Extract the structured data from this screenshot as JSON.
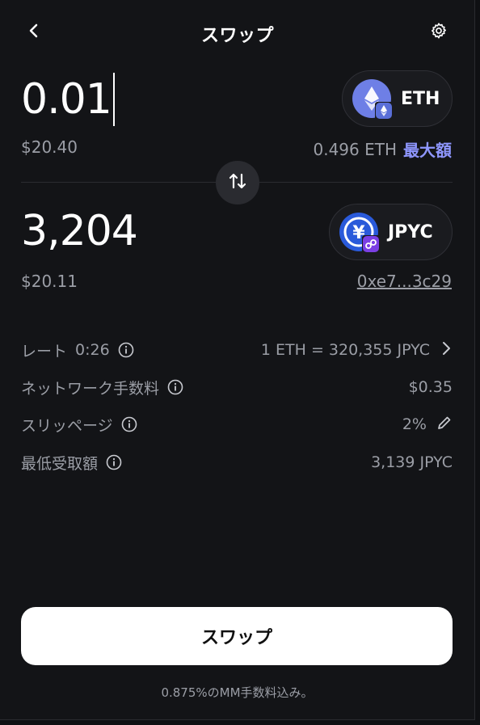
{
  "header": {
    "title": "スワップ",
    "back_icon": "chevron-left-icon",
    "settings_icon": "gear-icon"
  },
  "from": {
    "amount": "0.01",
    "usd": "$20.40",
    "token": "ETH",
    "balance": "0.496 ETH",
    "max_label": "最大額"
  },
  "to": {
    "amount": "3,204",
    "usd": "$20.11",
    "token": "JPYC",
    "address": "0xe7...3c29"
  },
  "details": {
    "rate_label": "レート",
    "rate_timer": "0:26",
    "rate_value": "1 ETH = 320,355 JPYC",
    "network_fee_label": "ネットワーク手数料",
    "network_fee_value": "$0.35",
    "slippage_label": "スリッページ",
    "slippage_value": "2%",
    "min_received_label": "最低受取額",
    "min_received_value": "3,139 JPYC"
  },
  "cta": {
    "label": "スワップ"
  },
  "footer": {
    "fee_note": "0.875%のMM手数料込み。"
  },
  "colors": {
    "background": "#131417",
    "accent": "#8f97ff",
    "eth": "#6e7fe6",
    "jpyc": "#2a5ada",
    "polygon": "#7b3fe4"
  }
}
